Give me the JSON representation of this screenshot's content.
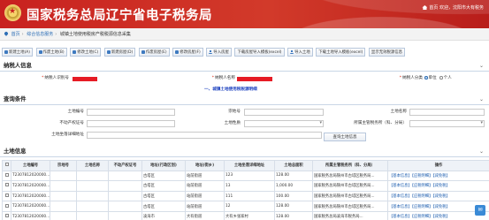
{
  "header": {
    "title": "国家税务总局辽宁省电子税务局",
    "user_text": "首页  欢迎，沈阳市大有税务"
  },
  "breadcrumb": [
    "首页",
    "综合信息服务",
    "城镇土地使用税房产税税源信息采集"
  ],
  "toolbar": [
    {
      "label": "新建土地(A)",
      "icon": "plus-icon"
    },
    {
      "label": "作废土地(B)",
      "icon": "delete-icon"
    },
    {
      "label": "修改土地(C)",
      "icon": "edit-icon"
    },
    {
      "label": "新建房屋(D)",
      "icon": "plus-icon"
    },
    {
      "label": "作废房屋(E)",
      "icon": "delete-icon"
    },
    {
      "label": "修改房屋(F)",
      "icon": "edit-icon"
    },
    {
      "label": "导入房屋",
      "icon": "download-icon"
    },
    {
      "label": "下载房屋导入模板(excel)",
      "icon": "none"
    },
    {
      "label": "导入土地",
      "icon": "download-icon"
    },
    {
      "label": "下载土地导入模板(excel)",
      "icon": "none"
    },
    {
      "label": "显示无效税源信息",
      "icon": "none"
    }
  ],
  "taxpayer": {
    "section_title": "纳税人信息",
    "id_label": "纳税人识别号",
    "name_label": "纳税人名称",
    "type_label": "纳税人分类",
    "type_options": [
      "单位",
      "个人"
    ],
    "type_selected": "单位",
    "notice": "一、城镇土地使用税税源明细"
  },
  "query": {
    "section_title": "查询条件",
    "fields": {
      "land_no": "土地编号",
      "deed_no": "宗地号",
      "land_name": "土地名称",
      "cert_no": "不动产权证号",
      "land_nature": "土地性质",
      "district": "所属主管税务所（科、分局）",
      "address": "土地坐落详细地址"
    },
    "button": "查询土地信息"
  },
  "land": {
    "section_title": "土地信息",
    "columns": [
      "",
      "土地编号",
      "宗地号",
      "土地名称",
      "不动产权证号",
      "地址(行政区划)",
      "地址(街乡)",
      "土地坐落详细地址",
      "土地总面积",
      "所属主管税务所（科、分局）",
      "操作"
    ],
    "rows": [
      {
        "no": "T2307812020000...",
        "deed": "",
        "name": "",
        "cert": "",
        "region": "古塔区",
        "street": "站前街道",
        "addr": "123",
        "area": "128.00",
        "office": "国家税务总局锦州市古塔区税务局...",
        "ops": "【基本信息】【应税明细】【减免税】"
      },
      {
        "no": "T2307812020000...",
        "deed": "",
        "name": "",
        "cert": "",
        "region": "古塔区",
        "street": "站前街道",
        "addr": "13",
        "area": "1,000.00",
        "office": "国家税务总局锦州市古塔区税务局...",
        "ops": "【基本信息】【应税明细】【减免税】"
      },
      {
        "no": "T2307812020000...",
        "deed": "",
        "name": "",
        "cert": "",
        "region": "古塔区",
        "street": "站前街道",
        "addr": "111",
        "area": "100.00",
        "office": "国家税务总局锦州市古塔区税务局...",
        "ops": "【基本信息】【应税明细】【减免税】"
      },
      {
        "no": "T2307812020000...",
        "deed": "",
        "name": "",
        "cert": "",
        "region": "古塔区",
        "street": "站前街道",
        "addr": "12",
        "area": "128.00",
        "office": "国家税务总局锦州市古塔区税务局...",
        "ops": "【基本信息】【应税明细】【减免税】"
      },
      {
        "no": "T2307812020000...",
        "deed": "",
        "name": "",
        "cert": "",
        "region": "凌海市",
        "street": "大有街道",
        "addr": "大有乡张家村",
        "area": "128.00",
        "office": "国家税务总局凌海市税务局...",
        "ops": "【基本信息】【应税明细】【减免税】"
      }
    ]
  },
  "colors": {
    "header_red": "#c8211f",
    "link_blue": "#1f5fb0",
    "redaction": "#e61c25"
  }
}
